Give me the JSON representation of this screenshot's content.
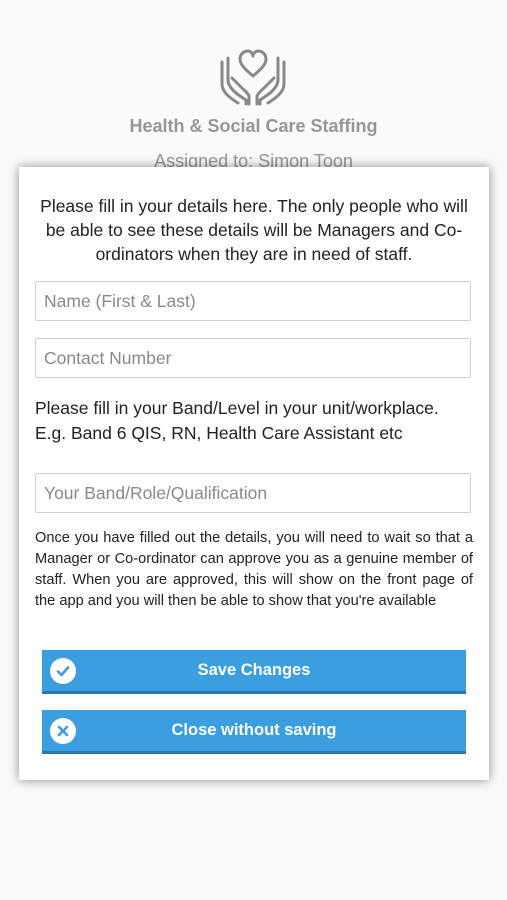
{
  "header": {
    "title": "Health & Social Care Staffing",
    "assigned": "Assigned to: Simon Toon",
    "logo_icon": "heart-hands-icon"
  },
  "dialog": {
    "intro": "Please fill in your details here. The only people who will be able to see these details will be Managers and Co-ordinators when they are in need of staff.",
    "name_placeholder": "Name (First & Last)",
    "name_value": "",
    "contact_placeholder": "Contact Number",
    "contact_value": "",
    "band_label": "Please fill in your Band/Level in your unit/workplace. E.g. Band 6 QIS, RN, Health Care Assistant etc",
    "band_placeholder": "Your Band/Role/Qualification",
    "band_value": "",
    "info": "Once you have filled out the details, you will need to wait so that a Manager or Co-ordinator can approve you as a genuine member of staff. When you are approved, this will show on the front page of the app and you will then be able to show that you're available",
    "save_label": "Save Changes",
    "save_icon": "check-circle-icon",
    "close_label": "Close without saving",
    "close_icon": "x-circle-icon"
  },
  "colors": {
    "button": "#3a9ee0",
    "header_text": "#9a9a9a"
  }
}
